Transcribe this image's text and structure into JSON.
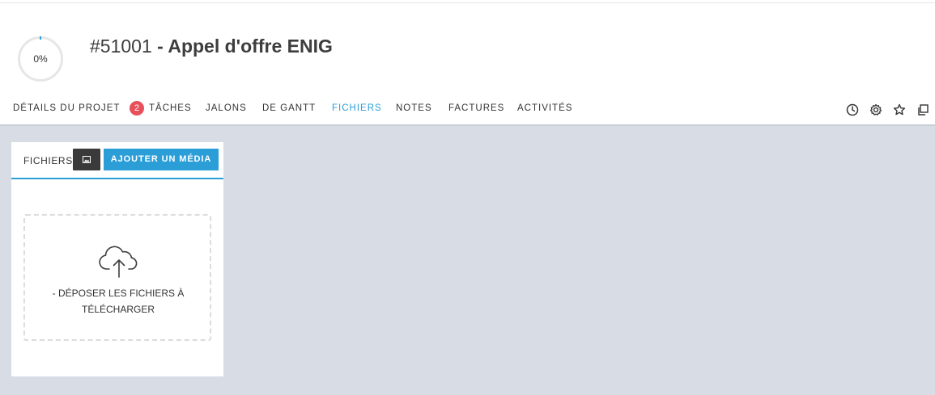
{
  "project": {
    "progress_label": "0%",
    "progress_value": 0,
    "number": "#51001",
    "name": " - Appel d'offre ENIG"
  },
  "tabs": [
    {
      "label": "DÉTAILS DU PROJET"
    },
    {
      "label": "TÂCHES",
      "badge": "2"
    },
    {
      "label": "JALONS"
    },
    {
      "label": "DE GANTT"
    },
    {
      "label": "FICHIERS",
      "active": true
    },
    {
      "label": "NOTES"
    },
    {
      "label": "FACTURES"
    },
    {
      "label": "ACTIVITÉS"
    }
  ],
  "toolbar_icons": [
    "clock-icon",
    "gear-icon",
    "star-icon",
    "copy-icon"
  ],
  "files_panel": {
    "title": "FICHIERS",
    "image_button_icon": "image-icon",
    "add_media_label": "AJOUTER UN MÉDIA",
    "dropzone_icon": "cloud-upload-icon",
    "dropzone_text": "- DÉPOSER LES FICHIERS À TÉLÉCHARGER"
  },
  "colors": {
    "accent": "#2b9ed8",
    "badge": "#e8505b",
    "background": "#d8dde5"
  }
}
